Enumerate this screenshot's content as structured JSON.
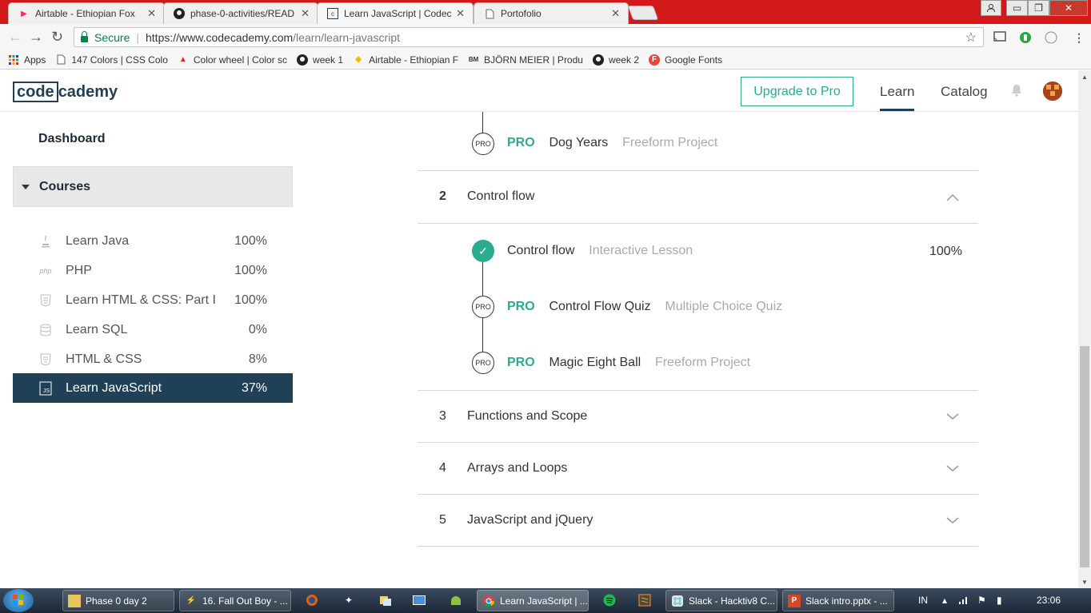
{
  "browser": {
    "tabs": [
      {
        "title": "Airtable - Ethiopian Fox",
        "icon": "airtable-icon"
      },
      {
        "title": "phase-0-activities/READ",
        "icon": "github-icon"
      },
      {
        "title": "Learn JavaScript | Codec",
        "icon": "codecademy-icon"
      },
      {
        "title": "Portofolio",
        "icon": "page-icon"
      }
    ],
    "secure_label": "Secure",
    "url_base": "https://www.codecademy.com",
    "url_path": "/learn/learn-javascript",
    "bookmarks": [
      {
        "label": "Apps",
        "icon": "apps-grid-icon"
      },
      {
        "label": "147 Colors | CSS Colo",
        "icon": "page-icon"
      },
      {
        "label": "Color wheel | Color sc",
        "icon": "adobe-icon"
      },
      {
        "label": "week 1",
        "icon": "github-icon"
      },
      {
        "label": "Airtable - Ethiopian F",
        "icon": "airtable-icon"
      },
      {
        "label": "BJÖRN MEIER | Produ",
        "icon": "bm-icon"
      },
      {
        "label": "week 2",
        "icon": "github-icon"
      },
      {
        "label": "Google Fonts",
        "icon": "google-fonts-icon"
      }
    ]
  },
  "header": {
    "logo_box": "code",
    "logo_rest": "cademy",
    "upgrade_label": "Upgrade to Pro",
    "nav_learn": "Learn",
    "nav_catalog": "Catalog"
  },
  "sidebar": {
    "dashboard": "Dashboard",
    "courses_label": "Courses",
    "courses": [
      {
        "name": "Learn Java",
        "pct": "100%",
        "icon": "java-icon"
      },
      {
        "name": "PHP",
        "pct": "100%",
        "icon": "php-icon"
      },
      {
        "name": "Learn HTML & CSS: Part I",
        "pct": "100%",
        "icon": "html5-icon"
      },
      {
        "name": "Learn SQL",
        "pct": "0%",
        "icon": "database-icon"
      },
      {
        "name": "HTML & CSS",
        "pct": "8%",
        "icon": "html5-icon"
      },
      {
        "name": "Learn JavaScript",
        "pct": "37%",
        "icon": "js-icon"
      }
    ]
  },
  "syllabus": {
    "pro_label": "PRO",
    "pro_badge": "PRO",
    "top_item": {
      "title": "Dog Years",
      "kind": "Freeform Project"
    },
    "unit2": {
      "num": "2",
      "title": "Control flow",
      "items": [
        {
          "title": "Control flow",
          "kind": "Interactive Lesson",
          "pct": "100%"
        },
        {
          "title": "Control Flow Quiz",
          "kind": "Multiple Choice Quiz"
        },
        {
          "title": "Magic Eight Ball",
          "kind": "Freeform Project"
        }
      ]
    },
    "units": [
      {
        "num": "3",
        "title": "Functions and Scope"
      },
      {
        "num": "4",
        "title": "Arrays and Loops"
      },
      {
        "num": "5",
        "title": "JavaScript and jQuery"
      }
    ]
  },
  "taskbar": {
    "buttons": [
      {
        "label": "Phase 0 day 2",
        "icon": "folder-icon"
      },
      {
        "label": "16. Fall Out Boy - ...",
        "icon": "winamp-icon"
      },
      {
        "label": "Learn JavaScript | ...",
        "icon": "chrome-icon"
      },
      {
        "label": "Slack - Hacktiv8 C...",
        "icon": "slack-icon"
      },
      {
        "label": "Slack intro.pptx - ...",
        "icon": "powerpoint-icon"
      }
    ],
    "lang": "IN",
    "time": "23:06"
  },
  "colors": {
    "accent": "#2bab8f",
    "navy": "#1f4056",
    "chrome_tabstrip": "#d1191c"
  }
}
